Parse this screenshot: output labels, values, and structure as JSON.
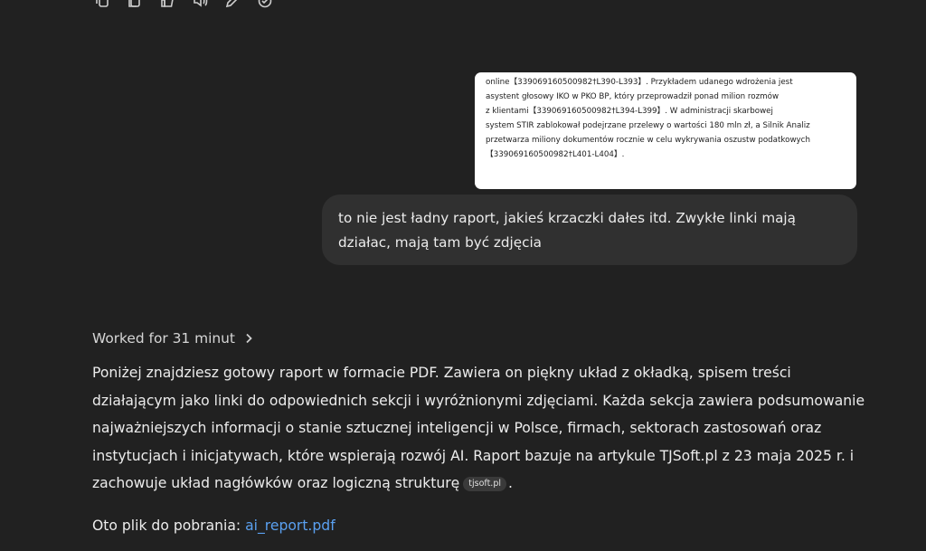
{
  "toolbar": {
    "icons": [
      "copy-icon",
      "duplicate-icon",
      "thumbs-up-icon",
      "speaker-icon",
      "edit-icon",
      "share-icon"
    ]
  },
  "image_card": {
    "lines": [
      "online【339069160500982†L390-L393】. Przykładem udanego wdrożenia jest",
      "asystent głosowy IKO w PKO BP, który przeprowadził ponad milion rozmów",
      "z klientami【339069160500982†L394-L399】. W administracji skarbowej",
      "system STIR zablokował podejrzane przelewy o wartości 180 mln zł, a Silnik Analiz",
      "przetwarza miliony dokumentów rocznie w celu wykrywania oszustw podatkowych",
      "【339069160500982†L401-L404】."
    ]
  },
  "user_message": {
    "text": "to nie jest ładny raport, jakieś krzaczki dałes itd. Zwykłe linki mają działac, mają tam być zdjęcia"
  },
  "worked": {
    "label": "Worked for 31 minut",
    "icon": "chevron-right-icon"
  },
  "answer": {
    "text": "Poniżej znajdziesz gotowy raport w formacie PDF. Zawiera on piękny układ z okładką, spisem treści działającym jako linki do odpowiednich sekcji i wyróżnionymi zdjęciami. Każda sekcja zawiera podsumowanie najważniejszych informacji o stanie sztucznej inteligencji w Polsce, firmach, sektorach zastosowań oraz instytucjach i inicjatywach, które wspierają rozwój AI. Raport bazuje na artykule TJSoft.pl z 23 maja 2025 r. i zachowuje układ nagłówków oraz logiczną strukturę",
    "citation": "tjsoft.pl",
    "end": "."
  },
  "download": {
    "prefix": "Oto plik do pobrania: ",
    "link_text": "ai_report.pdf"
  }
}
